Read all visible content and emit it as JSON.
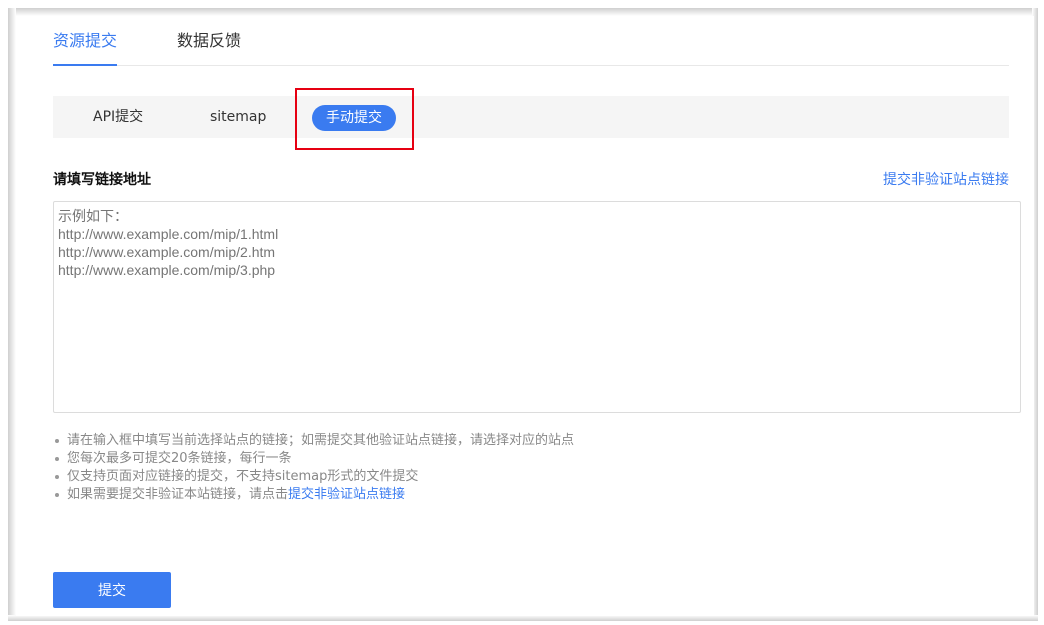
{
  "top_tabs": [
    {
      "label": "资源提交",
      "active": true
    },
    {
      "label": "数据反馈",
      "active": false
    }
  ],
  "sub_tabs": [
    {
      "label": "API提交",
      "active": false
    },
    {
      "label": "sitemap",
      "active": false
    },
    {
      "label": "手动提交",
      "active": true
    }
  ],
  "form": {
    "label": "请填写链接地址",
    "right_link": "提交非验证站点链接",
    "textarea_placeholder": "示例如下：\nhttp://www.example.com/mip/1.html\nhttp://www.example.com/mip/2.htm\nhttp://www.example.com/mip/3.php"
  },
  "notes": [
    {
      "text": "请在输入框中填写当前选择站点的链接；如需提交其他验证站点链接，请选择对应的站点"
    },
    {
      "text": "您每次最多可提交20条链接，每行一条"
    },
    {
      "text": "仅支持页面对应链接的提交，不支持sitemap形式的文件提交"
    },
    {
      "text": "如果需要提交非验证本站链接，请点击",
      "link": "提交非验证站点链接"
    }
  ],
  "submit_label": "提交",
  "colors": {
    "accent": "#3a7bf0",
    "highlight_border": "#e60012"
  }
}
